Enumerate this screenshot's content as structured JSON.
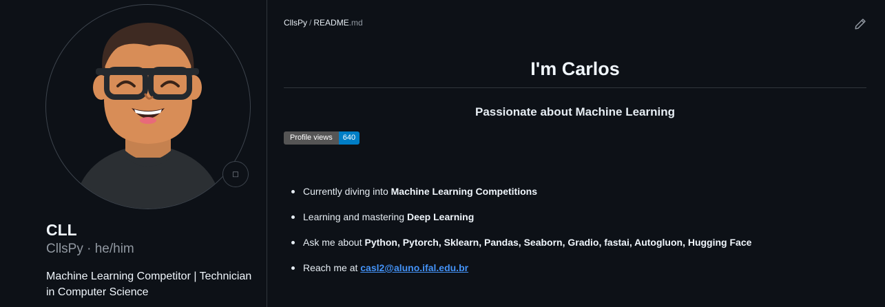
{
  "profile": {
    "name": "CLL",
    "username": "CllsPy",
    "separator": "·",
    "pronouns": "he/him",
    "bio": "Machine Learning Competitor | Technician in Computer Science",
    "status_icon": "smiley-icon"
  },
  "readme": {
    "path_owner": "CllsPy",
    "path_sep": "/",
    "path_file": "README",
    "path_ext": ".md",
    "edit_icon": "pencil-icon",
    "title": "I'm Carlos",
    "subtitle": "Passionate about Machine Learning",
    "badge": {
      "label": "Profile views",
      "value": "640"
    },
    "items": [
      {
        "prefix": "Currently diving into ",
        "bold": "Machine Learning Competitions"
      },
      {
        "prefix": "Learning and mastering ",
        "bold": "Deep Learning"
      },
      {
        "prefix": "Ask me about ",
        "bold": "Python, Pytorch, Sklearn, Pandas, Seaborn, Gradio, fastai, Autogluon, Hugging Face"
      },
      {
        "prefix": "Reach me at ",
        "link": "casl2@aluno.ifal.edu.br"
      }
    ]
  },
  "colors": {
    "background": "#0d1117",
    "link": "#4493f8",
    "badge_label_bg": "#555555",
    "badge_value_bg": "#007ec6"
  }
}
